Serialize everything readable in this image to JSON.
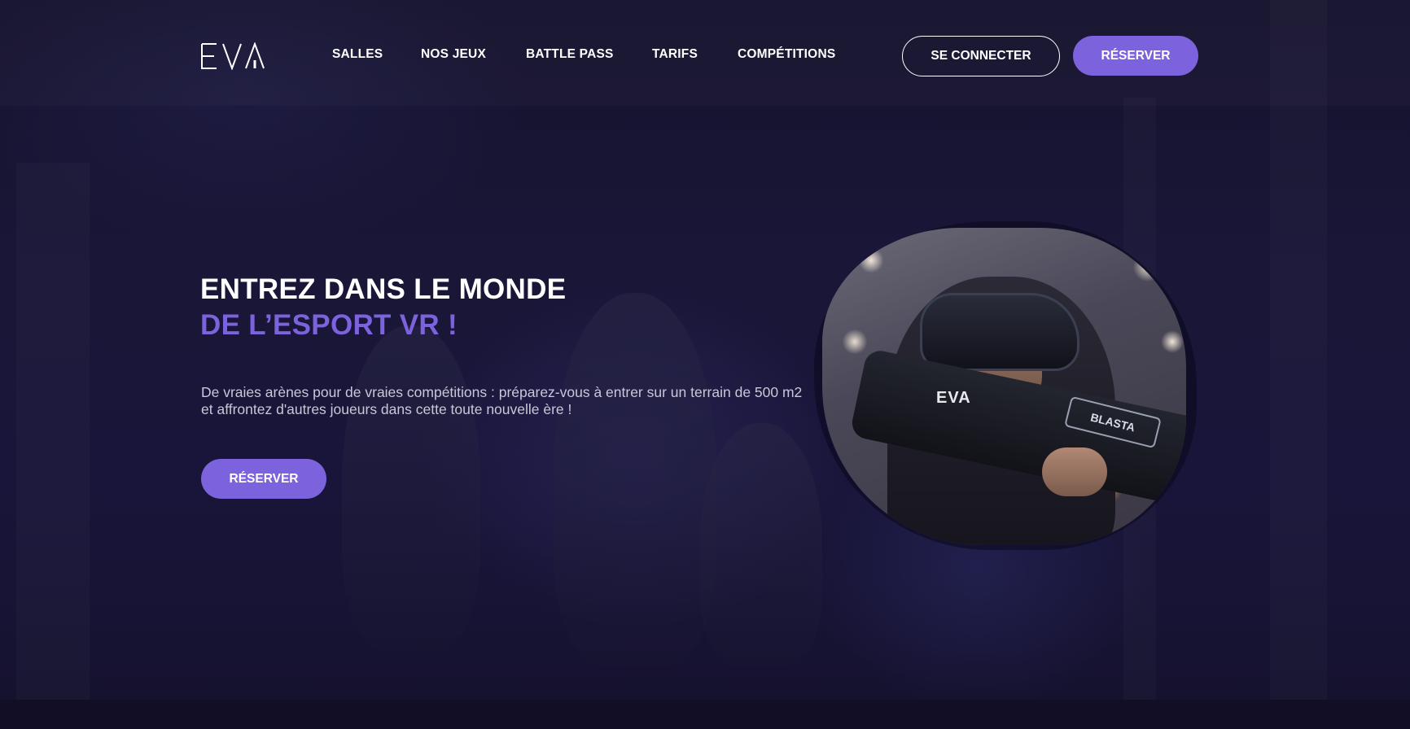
{
  "brand": {
    "logo_text": "EVA"
  },
  "nav": {
    "items": [
      {
        "label": "SALLES"
      },
      {
        "label": "NOS JEUX"
      },
      {
        "label": "BATTLE PASS"
      },
      {
        "label": "TARIFS"
      },
      {
        "label": "COMPÉTITIONS"
      }
    ]
  },
  "header_actions": {
    "login_label": "SE CONNECTER",
    "reserve_label": "RÉSERVER"
  },
  "hero": {
    "title_line1": "ENTREZ DANS LE MONDE",
    "title_line2": "DE L’ESPORT VR !",
    "description": "De vraies arènes pour de vraies compétitions : préparez-vous à entrer sur un terrain de 500 m2 et affrontez d'autres joueurs dans cette toute nouvelle ère !",
    "cta_label": "RÉSERVER",
    "photo": {
      "gun_label": "BLASTA",
      "jersey_mark": "EVA"
    }
  },
  "colors": {
    "accent": "#7c62dc",
    "background": "#15122e",
    "text": "#ffffff"
  }
}
